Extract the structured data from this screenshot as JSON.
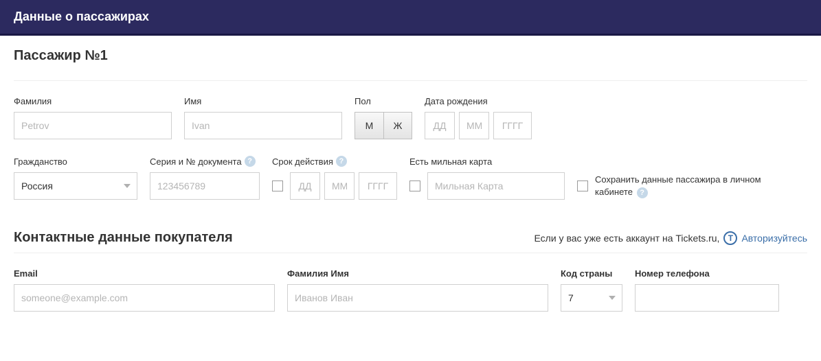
{
  "header": {
    "title": "Данные о пассажирах"
  },
  "passenger": {
    "title": "Пассажир №1",
    "lastname_label": "Фамилия",
    "lastname_placeholder": "Petrov",
    "firstname_label": "Имя",
    "firstname_placeholder": "Ivan",
    "gender_label": "Пол",
    "gender_m": "М",
    "gender_f": "Ж",
    "dob_label": "Дата рождения",
    "dob_dd": "ДД",
    "dob_mm": "ММ",
    "dob_yyyy": "ГГГГ",
    "citizenship_label": "Гражданство",
    "citizenship_value": "Россия",
    "docnum_label": "Серия и № документа",
    "docnum_placeholder": "123456789",
    "expiry_label": "Срок действия",
    "expiry_dd": "ДД",
    "expiry_mm": "ММ",
    "expiry_yyyy": "ГГГГ",
    "miles_label": "Есть мильная карта",
    "miles_placeholder": "Мильная Карта",
    "save_label": "Сохранить данные пассажира в личном кабинете"
  },
  "contact": {
    "title": "Контактные данные покупателя",
    "auth_prompt": "Если у вас уже есть аккаунт на Tickets.ru,",
    "auth_icon": "Т",
    "auth_link": "Авторизуйтесь",
    "email_label": "Email",
    "email_placeholder": "someone@example.com",
    "fullname_label": "Фамилия Имя",
    "fullname_placeholder": "Иванов Иван",
    "country_code_label": "Код страны",
    "country_code_value": "7",
    "phone_label": "Номер телефона"
  }
}
